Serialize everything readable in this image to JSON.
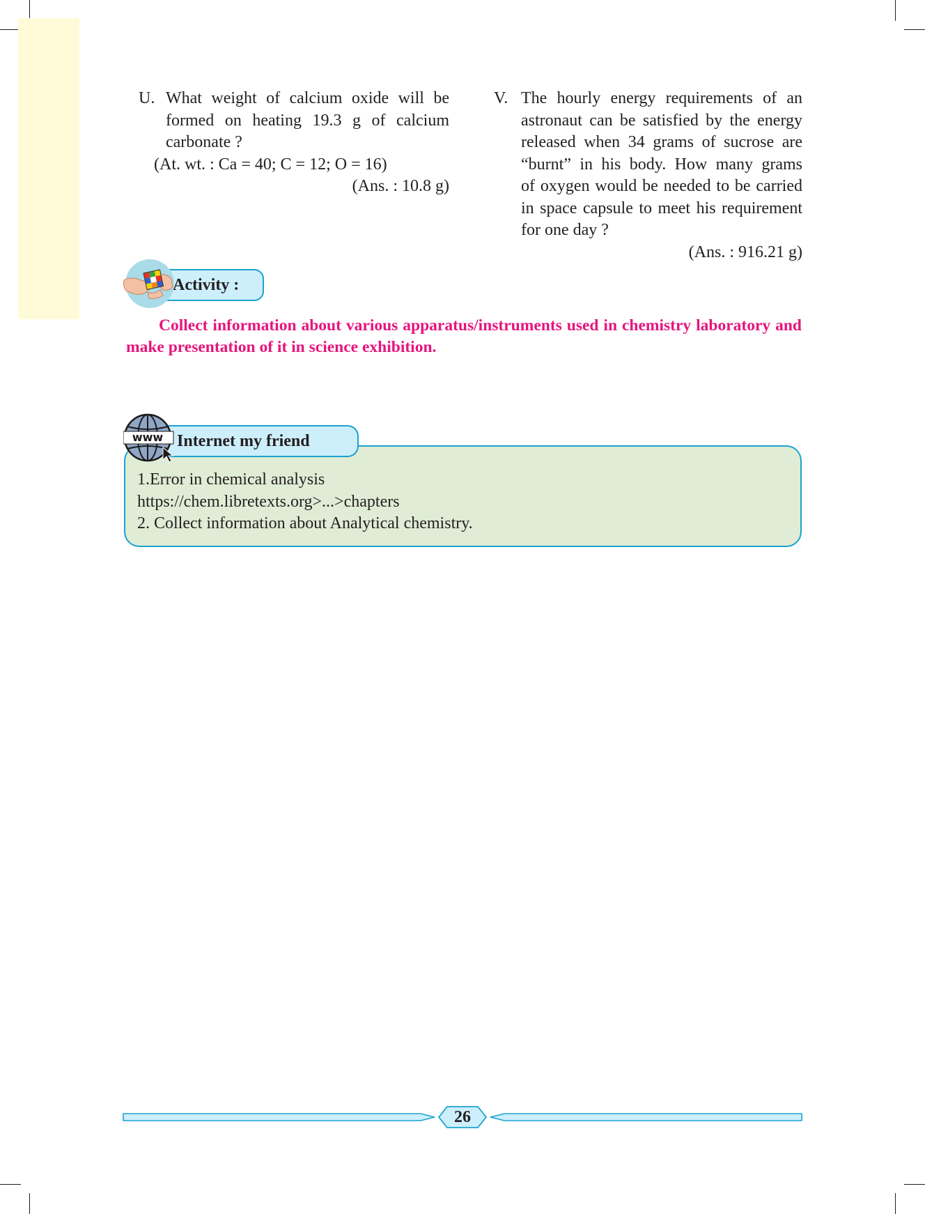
{
  "questions": {
    "u": {
      "label": "U.",
      "lines": [
        "What weight of calcium oxide will be",
        "formed on heating 19.3 g of calcium",
        "carbonate ?"
      ],
      "atomic_weights": "(At. wt. : Ca = 40; C = 12; O = 16)",
      "answer": "(Ans. : 10.8 g)"
    },
    "v": {
      "label": "V.",
      "lines": [
        "The hourly energy requirements of an",
        "astronaut can be satisfied by the energy",
        "released when 34 grams of sucrose are",
        "“burnt” in his body. How many grams",
        "of oxygen would be needed to be carried",
        "in space capsule to meet his requirement",
        "for one day ?"
      ],
      "answer": "(Ans. : 916.21 g)"
    }
  },
  "activity": {
    "title": "Activity :",
    "text": "Collect information about various apparatus/instruments used in chemistry laboratory and make presentation of it in science exhibition."
  },
  "internet": {
    "title": "Internet my friend",
    "globe_text": "www",
    "items": [
      "1.Error in chemical analysis",
      "https://chem.libretexts.org>...>chapters",
      "2. Collect information about Analytical chemistry."
    ]
  },
  "page_number": "26",
  "colors": {
    "accent_magenta": "#e6157d",
    "badge_blue": "#1ba3cf",
    "badge_fill": "#cdeefb",
    "box_fill": "#e0ecd5",
    "margin_strip": "#fffbd8"
  },
  "icons": [
    "rubiks-cube-hands-icon",
    "globe-www-icon",
    "cursor-arrow-icon"
  ]
}
